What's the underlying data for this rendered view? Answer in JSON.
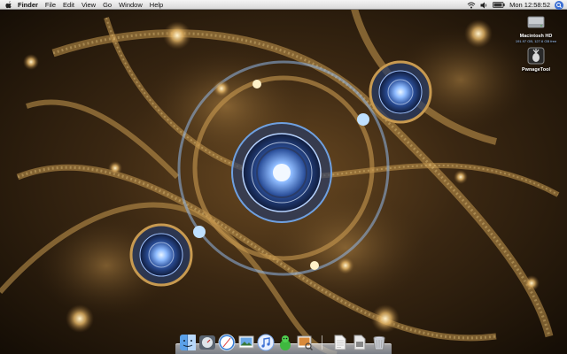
{
  "menubar": {
    "app_name": "Finder",
    "menus": [
      "File",
      "Edit",
      "View",
      "Go",
      "Window",
      "Help"
    ],
    "clock": "Mon 12:58:52"
  },
  "desktop": {
    "icons": [
      {
        "label": "Macintosh HD",
        "sublabel": "191.97 GB, 127.6 GB free",
        "icon": "hard-drive-icon"
      },
      {
        "label": "PwnageTool",
        "icon": "pineapple-app-icon"
      }
    ]
  },
  "dock": {
    "apps": [
      {
        "name": "Finder",
        "icon": "finder-icon"
      },
      {
        "name": "Dashboard",
        "icon": "dashboard-icon"
      },
      {
        "name": "Safari",
        "icon": "safari-icon"
      },
      {
        "name": "iPhoto",
        "icon": "iphoto-icon"
      },
      {
        "name": "iTunes",
        "icon": "itunes-icon"
      },
      {
        "name": "Adium",
        "icon": "adium-icon"
      },
      {
        "name": "Preview",
        "icon": "preview-icon"
      }
    ],
    "stacks": [
      {
        "name": "Documents",
        "icon": "document-stack-icon"
      },
      {
        "name": "Downloads",
        "icon": "downloads-stack-icon"
      },
      {
        "name": "Trash",
        "icon": "trash-icon"
      }
    ]
  },
  "colors": {
    "wallpaper_bg": "#1a1208",
    "fractal_gold": "#c89a50",
    "fractal_blue": "#4a78c8"
  }
}
